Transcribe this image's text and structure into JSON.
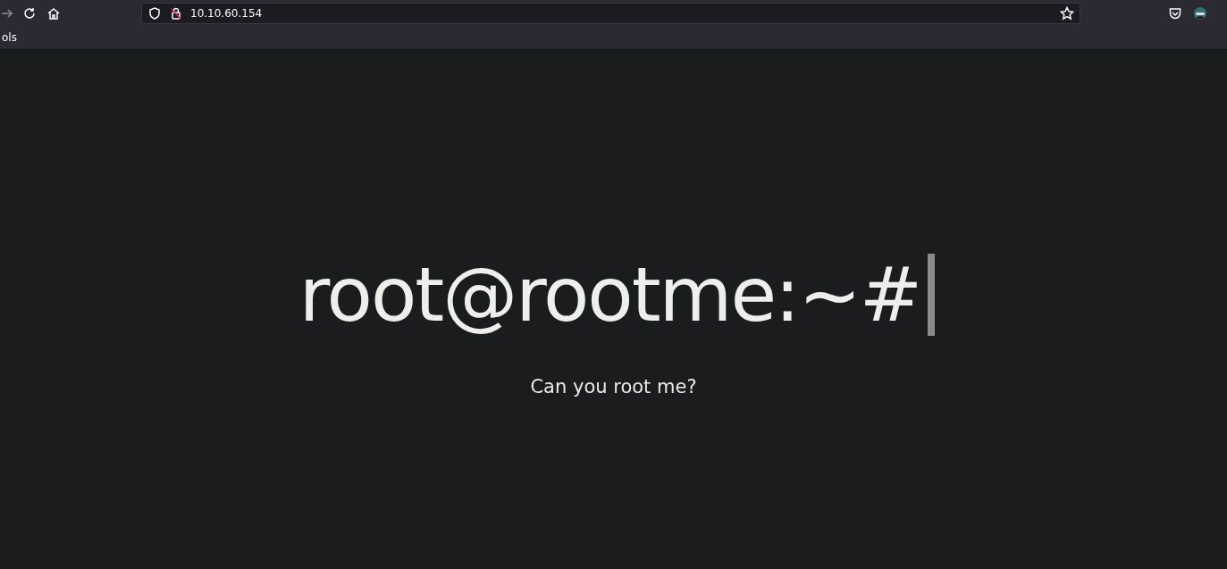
{
  "browser": {
    "url": "10.10.60.154",
    "bookmarks": [
      "ols"
    ]
  },
  "page": {
    "heading": "root@rootme:~#",
    "subtitle": "Can you root me?"
  }
}
